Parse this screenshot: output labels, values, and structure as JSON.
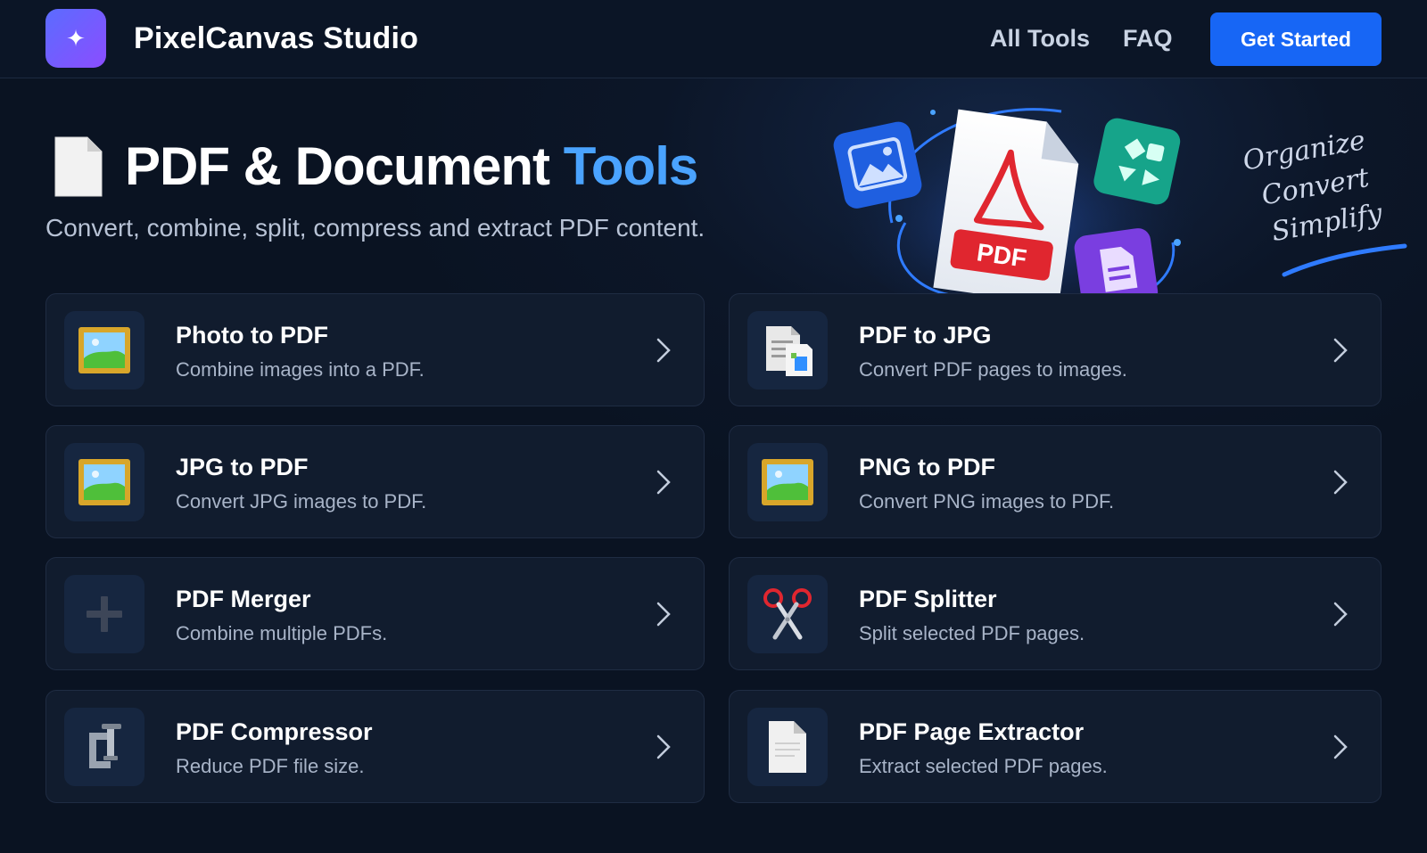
{
  "header": {
    "logo_icon": "sparkle-icon",
    "brand": "PixelCanvas Studio",
    "nav": [
      {
        "label": "All Tools"
      },
      {
        "label": "FAQ"
      }
    ],
    "cta_label": "Get Started"
  },
  "hero": {
    "title_main": "PDF & Document ",
    "title_accent": "Tools",
    "subtitle": "Convert, combine, split, compress and extract PDF content.",
    "art_badge": "PDF",
    "tagline": [
      "Organize",
      "Convert",
      "Simplify"
    ]
  },
  "tools": [
    {
      "title": "Photo to PDF",
      "desc": "Combine images into a PDF.",
      "icon": "picture-frame-icon"
    },
    {
      "title": "PDF to JPG",
      "desc": "Convert PDF pages to images.",
      "icon": "document-image-icon"
    },
    {
      "title": "JPG to PDF",
      "desc": "Convert JPG images to PDF.",
      "icon": "picture-frame-icon"
    },
    {
      "title": "PNG to PDF",
      "desc": "Convert PNG images to PDF.",
      "icon": "picture-frame-icon"
    },
    {
      "title": "PDF Merger",
      "desc": "Combine multiple PDFs.",
      "icon": "plus-icon"
    },
    {
      "title": "PDF Splitter",
      "desc": "Split selected PDF pages.",
      "icon": "scissors-icon"
    },
    {
      "title": "PDF Compressor",
      "desc": "Reduce PDF file size.",
      "icon": "clamp-icon"
    },
    {
      "title": "PDF Page Extractor",
      "desc": "Extract selected PDF pages.",
      "icon": "page-icon"
    }
  ],
  "colors": {
    "background": "#0b1424",
    "accent": "#4aa3ff",
    "cta": "#1766f5",
    "card": "#111c2e"
  }
}
